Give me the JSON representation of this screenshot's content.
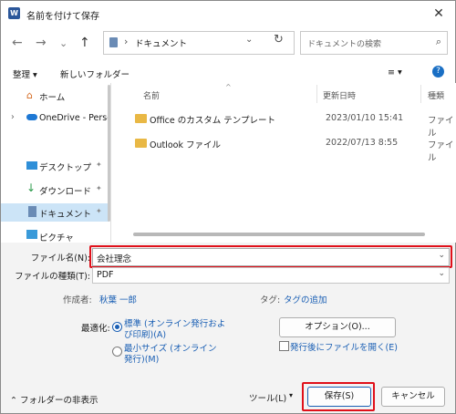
{
  "window": {
    "title": "名前を付けて保存",
    "app_icon": "W",
    "close_glyph": "✕"
  },
  "nav": {
    "back": "←",
    "forward": "→",
    "recent": "⌄",
    "up": "↑"
  },
  "address": {
    "sep": "›",
    "path": "ドキュメント",
    "dropdown": "⌄",
    "refresh": "↻"
  },
  "search": {
    "placeholder": "ドキュメントの検索",
    "icon": "⌕"
  },
  "toolbar": {
    "organize": "整理 ▾",
    "new_folder": "新しいフォルダー",
    "view": "≡ ▾",
    "help": "?"
  },
  "sidebar": {
    "items": [
      {
        "label": "ホーム"
      },
      {
        "label": "OneDrive - Perso"
      },
      {
        "label": "デスクトップ"
      },
      {
        "label": "ダウンロード"
      },
      {
        "label": "ドキュメント"
      },
      {
        "label": "ピクチャ"
      }
    ],
    "expand": "›",
    "pin": "📌"
  },
  "files": {
    "columns": {
      "name": "名前",
      "date": "更新日時",
      "type": "種類"
    },
    "rows": [
      {
        "name": "Office のカスタム テンプレート",
        "date": "2023/01/10 15:41",
        "type": "ファイル"
      },
      {
        "name": "Outlook ファイル",
        "date": "2022/07/13 8:55",
        "type": "ファイル"
      }
    ]
  },
  "form": {
    "filename_label": "ファイル名(N):",
    "filename_value": "会社理念",
    "filetype_label": "ファイルの種類(T):",
    "filetype_value": "PDF",
    "author_label": "作成者:",
    "author_value": "秋葉 一郎",
    "tags_label": "タグ:",
    "tags_value": "タグの追加",
    "optimize_label": "最適化:",
    "opt_standard": "標準 (オンライン発行および印刷)(A)",
    "opt_min": "最小サイズ (オンライン発行)(M)",
    "options_button": "オプション(O)...",
    "open_after": "発行後にファイルを開く(E)",
    "dropdown": "⌄"
  },
  "footer": {
    "hide_folders": "フォルダーの非表示",
    "hide_icon": "⌃",
    "tools": "ツール(L)",
    "tools_arrow": "▾",
    "save": "保存(S)",
    "cancel": "キャンセル"
  }
}
